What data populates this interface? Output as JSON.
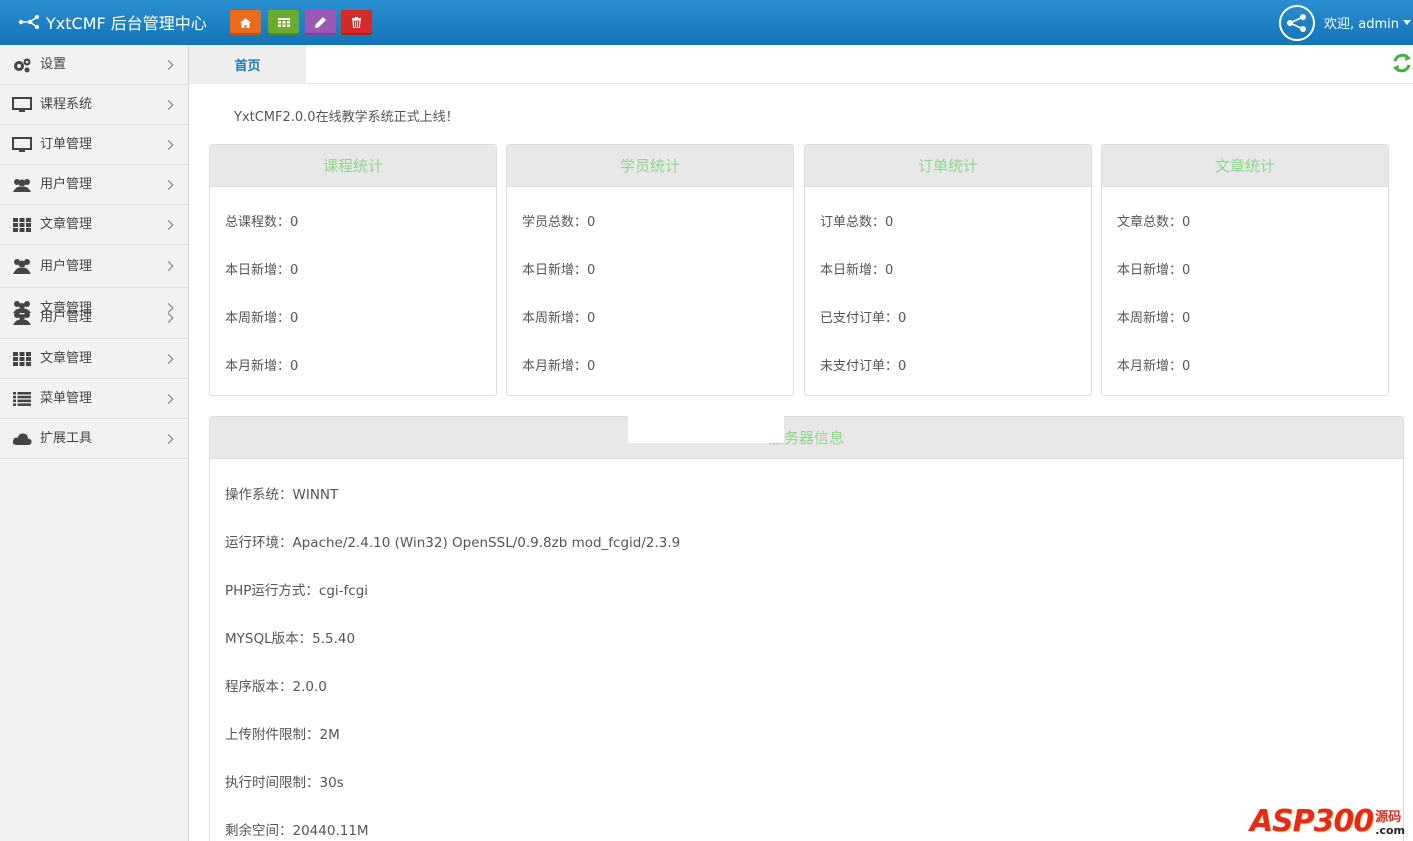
{
  "header": {
    "brand": "YxtCMF 后台管理中心",
    "buttons": [
      {
        "icon": "home-icon",
        "color": "#ee6a1b"
      },
      {
        "icon": "calendar-icon",
        "color": "#6bab2d"
      },
      {
        "icon": "pencil-icon",
        "color": "#9b59b6"
      },
      {
        "icon": "trash-icon",
        "color": "#d32a2a"
      }
    ],
    "user": "欢迎, admin"
  },
  "sidebar": {
    "items": [
      {
        "label": "设置",
        "icon": "gears-icon"
      },
      {
        "label": "课程系统",
        "icon": "monitor-icon"
      },
      {
        "label": "订单管理",
        "icon": "monitor-icon"
      },
      {
        "label": "用户管理",
        "icon": "users-icon"
      },
      {
        "label": "文章管理",
        "icon": "grid-icon"
      },
      {
        "label": "用户管理",
        "icon": "users-icon"
      },
      {
        "label_top": "文章管理",
        "label_bottom": "用户管理",
        "icon": "users-icon"
      },
      {
        "label": "文章管理",
        "icon": "grid-icon"
      },
      {
        "label": "菜单管理",
        "icon": "list-icon"
      },
      {
        "label": "扩展工具",
        "icon": "cloud-icon"
      }
    ]
  },
  "tabs": [
    {
      "label": "首页"
    }
  ],
  "notice": "YxtCMF2.0.0在线教学系统正式上线！",
  "stats": [
    {
      "title": "课程统计",
      "rows": [
        "总课程数：0",
        "本日新增：0",
        "本周新增：0",
        "本月新增：0"
      ]
    },
    {
      "title": "学员统计",
      "rows": [
        "学员总数：0",
        "本日新增：0",
        "本周新增：0",
        "本月新增：0"
      ]
    },
    {
      "title": "订单统计",
      "rows": [
        "订单总数：0",
        "本日新增：0",
        "已支付订单：0",
        "未支付订单：0"
      ]
    },
    {
      "title": "文章统计",
      "rows": [
        "文章总数：0",
        "本日新增：0",
        "本周新增：0",
        "本月新增：0"
      ]
    }
  ],
  "server": {
    "title": "服务器信息",
    "rows": [
      "操作系统：WINNT",
      "运行环境：Apache/2.4.10 (Win32) OpenSSL/0.9.8zb mod_fcgid/2.3.9",
      "PHP运行方式：cgi-fcgi",
      "MYSQL版本：5.5.40",
      "程序版本：2.0.0",
      "上传附件限制：2M",
      "执行时间限制：30s",
      "剩余空间：20440.11M"
    ]
  },
  "watermark": {
    "main": "ASP300",
    "cn": "源码",
    "com": ".com"
  },
  "colors": {
    "header": "#1a7fc4",
    "accent_green": "#8fd58f",
    "tab_text": "#1f79b7"
  }
}
